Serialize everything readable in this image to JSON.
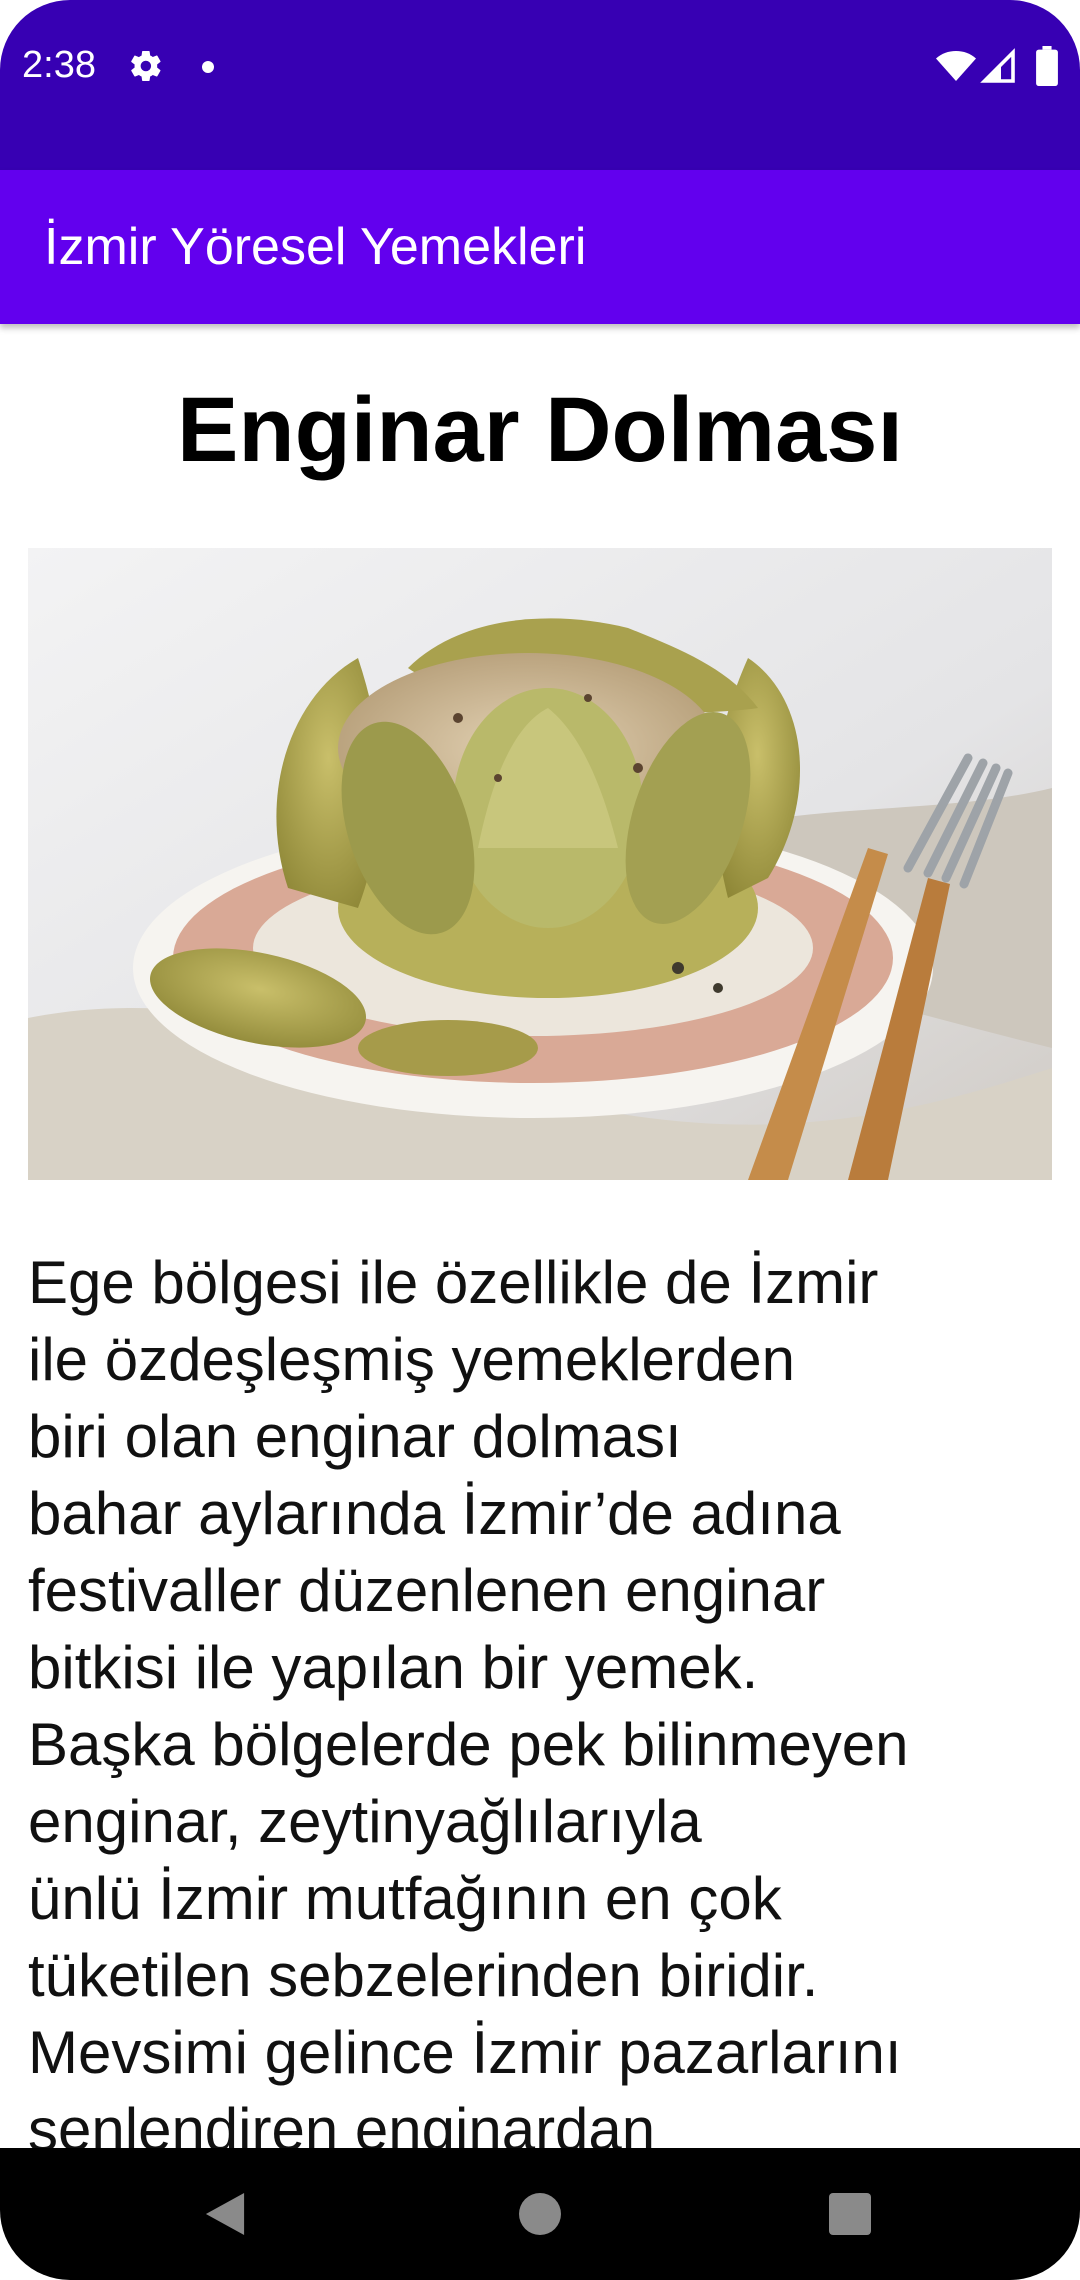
{
  "status_bar": {
    "time": "2:38",
    "icons": [
      "settings-icon",
      "notification-dot-icon",
      "wifi-icon",
      "cell-signal-icon",
      "battery-icon"
    ]
  },
  "app_bar": {
    "title": "İzmir Yöresel Yemekleri"
  },
  "recipe": {
    "title": "Enginar Dolması",
    "description_lines": [
      "Ege bölgesi ile özellikle de İzmir",
      "ile özdeşleşmiş yemeklerden",
      "biri olan enginar dolması",
      "bahar aylarında İzmir’de adına",
      "festivaller düzenlenen enginar",
      "bitkisi ile yapılan bir yemek.",
      "Başka bölgelerde pek bilinmeyen",
      "enginar, zeytinyağlılarıyla",
      "ünlü İzmir mutfağının en çok",
      "tüketilen sebzelerinden biridir.",
      "Mevsimi gelince İzmir pazarlarını",
      "şenlendiren enginardan"
    ]
  },
  "navigation": {
    "icons": [
      "back-icon",
      "home-icon",
      "recents-icon"
    ]
  },
  "colors": {
    "status_bar": "#3700B3",
    "app_bar": "#6200EE",
    "nav_bar": "#000000"
  }
}
